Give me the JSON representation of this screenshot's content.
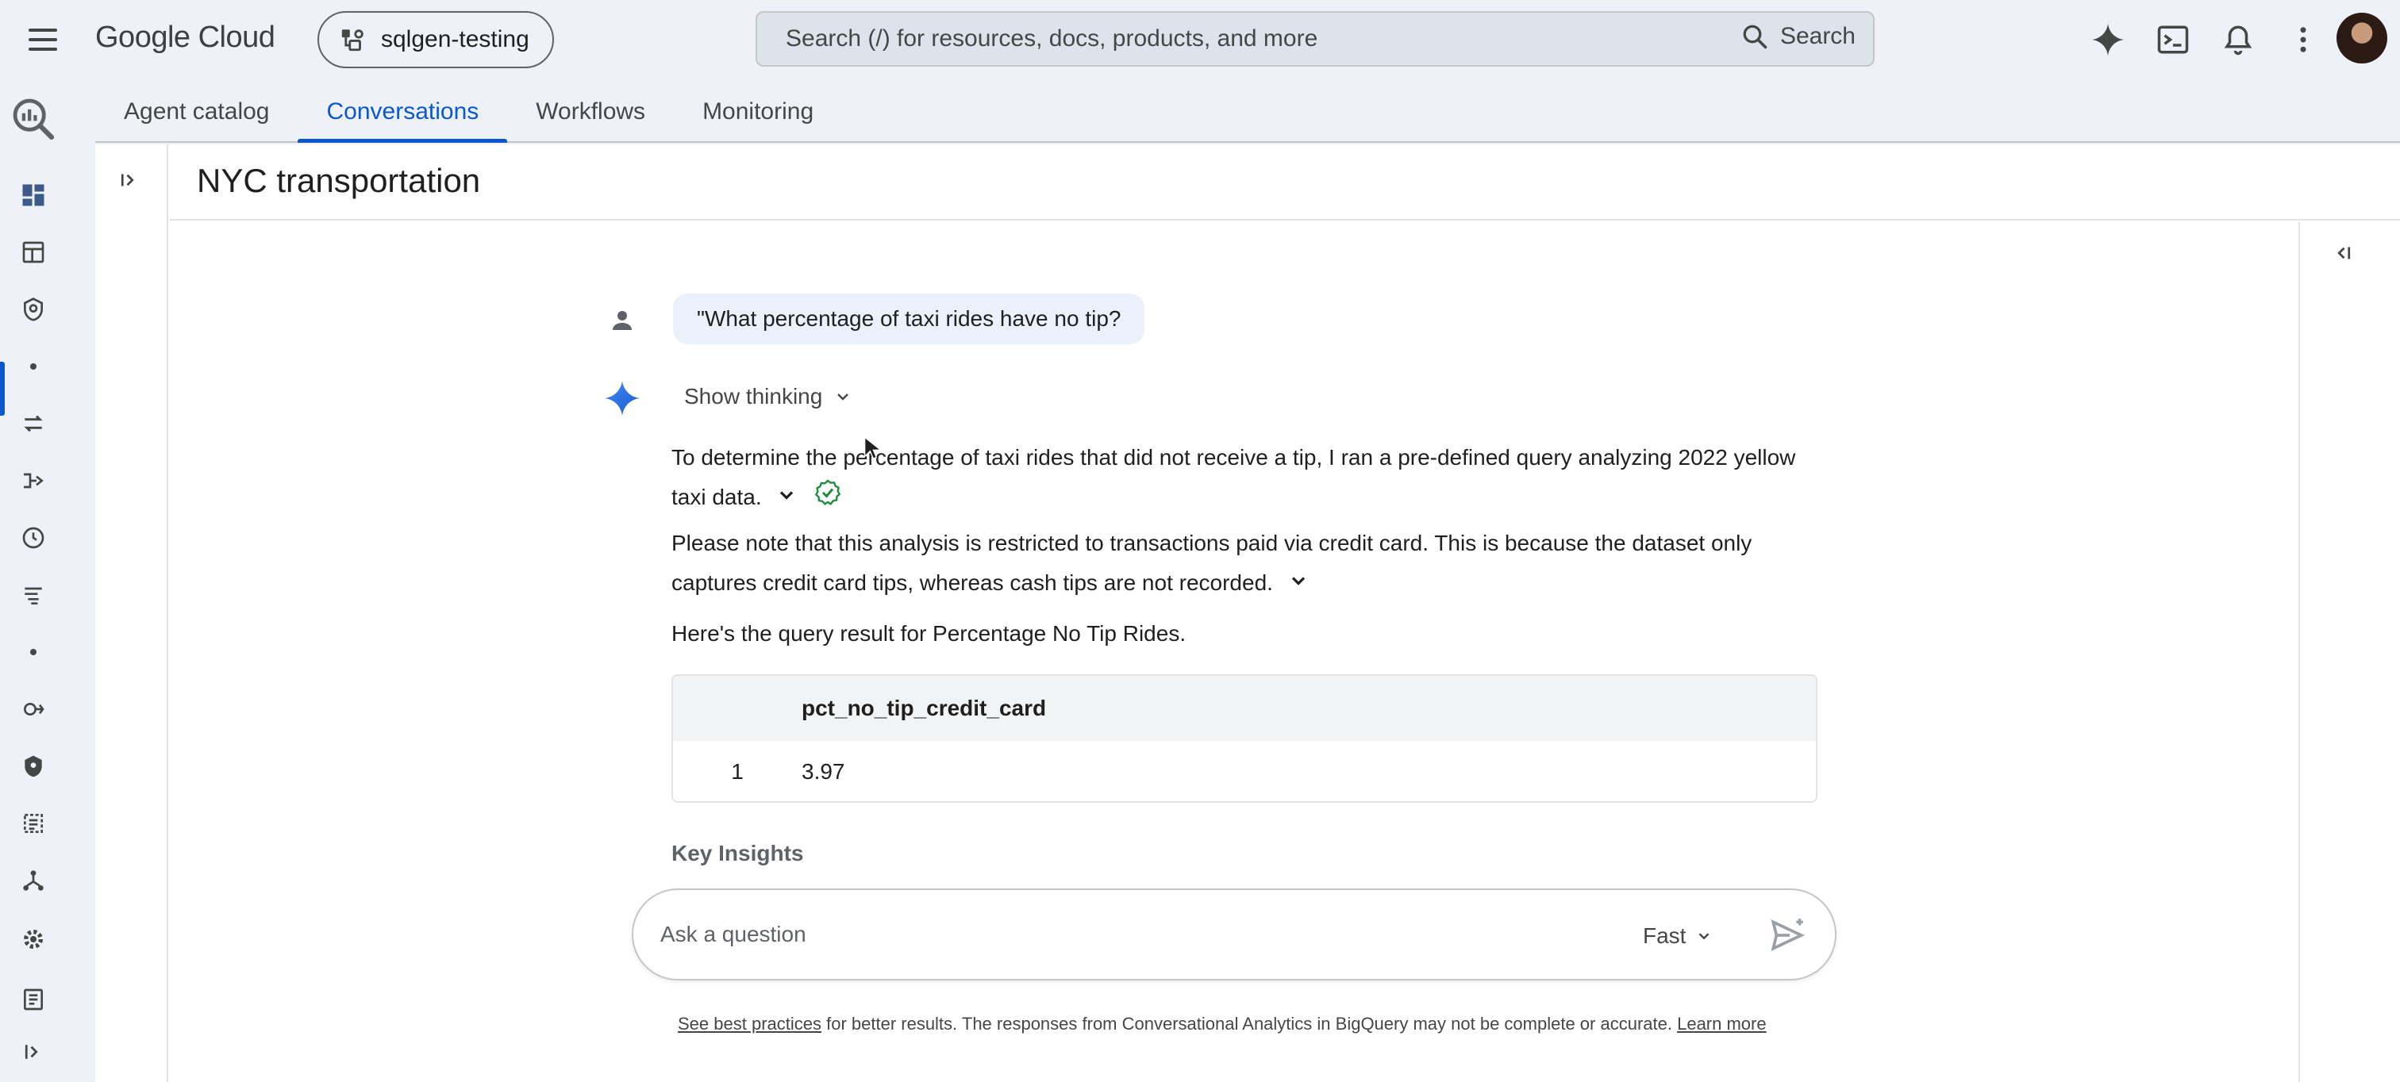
{
  "topbar": {
    "brand": "Google Cloud",
    "project": "sqlgen-testing",
    "search_placeholder": "Search (/) for resources, docs, products, and more",
    "search_button": "Search"
  },
  "tabs": [
    {
      "label": "Agent catalog",
      "active": false
    },
    {
      "label": "Conversations",
      "active": true
    },
    {
      "label": "Workflows",
      "active": false
    },
    {
      "label": "Monitoring",
      "active": false
    }
  ],
  "page": {
    "title": "NYC transportation"
  },
  "conversation": {
    "user_question": "\"What percentage of taxi rides have no tip?",
    "show_thinking": "Show thinking",
    "para1_line1": "To determine the percentage of taxi rides that did not receive a tip, I ran a pre-defined query analyzing 2022 yellow",
    "para1_line2": "taxi data.",
    "para2_line1": "Please note that this analysis is restricted to transactions paid via credit card. This is because the dataset only",
    "para2_line2": "captures credit card tips, whereas cash tips are not recorded.",
    "para3": "Here's the query result for Percentage No Tip Rides.",
    "table": {
      "columns": [
        "",
        "pct_no_tip_credit_card"
      ],
      "rows": [
        [
          "1",
          "3.97"
        ]
      ]
    },
    "key_insights": "Key Insights"
  },
  "composer": {
    "placeholder": "Ask a question",
    "mode": "Fast"
  },
  "disclaimer": {
    "link1": "See best practices",
    "text": " for better results. The responses from Conversational Analytics in BigQuery may not be complete or accurate. ",
    "link2": "Learn more"
  },
  "colors": {
    "accent": "#0b57d0",
    "background": "#eef2f8",
    "verified": "#1e8e3e"
  }
}
